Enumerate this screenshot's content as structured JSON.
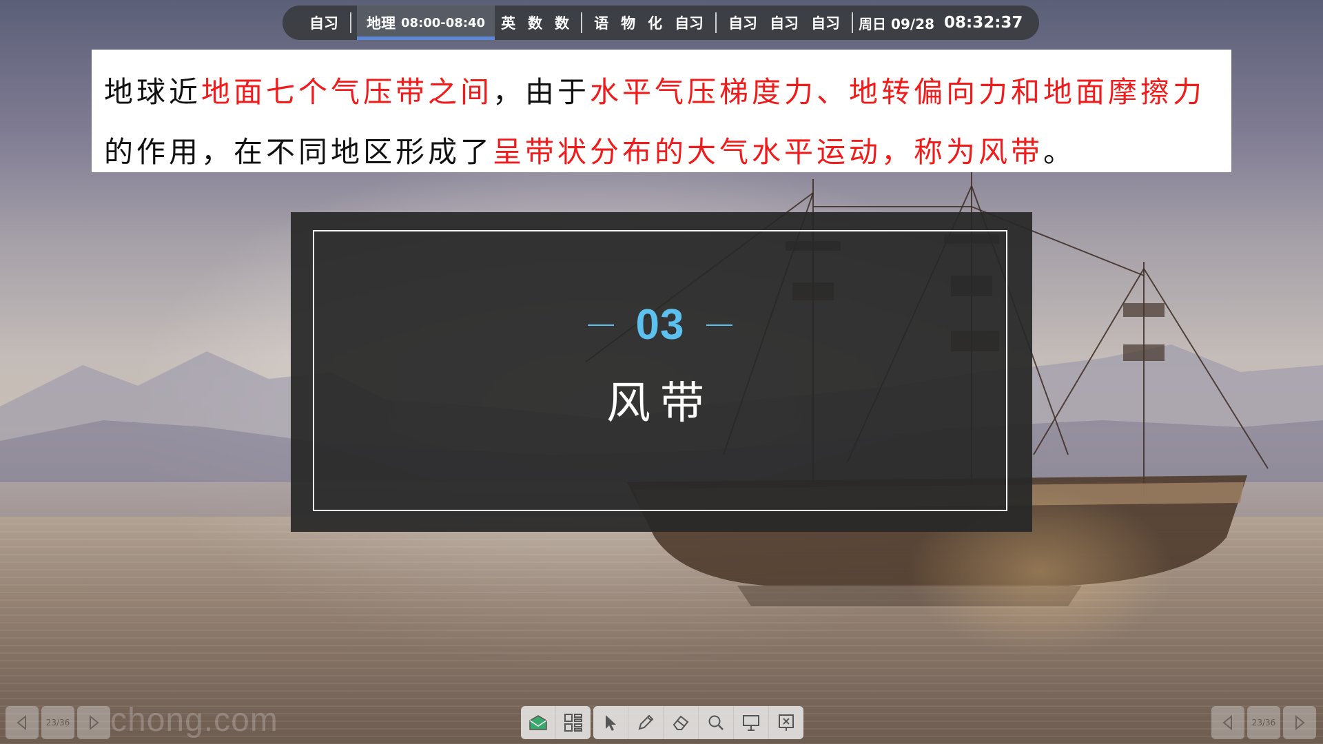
{
  "topbar": {
    "items": [
      {
        "label": "自习"
      },
      {
        "label": "地理",
        "time": "08:00-08:40",
        "active": true
      },
      {
        "label": "英"
      },
      {
        "label": "数"
      },
      {
        "label": "数"
      },
      {
        "label": "语"
      },
      {
        "label": "物"
      },
      {
        "label": "化"
      },
      {
        "label": "自习"
      },
      {
        "label": "自习"
      },
      {
        "label": "自习"
      },
      {
        "label": "自习"
      }
    ],
    "date": "周日 09/28",
    "clock": "08:32:37"
  },
  "definition": {
    "segments": [
      {
        "text": "地球近",
        "red": false
      },
      {
        "text": "地面七个气压带之间",
        "red": true
      },
      {
        "text": "，由于",
        "red": false
      },
      {
        "text": "水平气压梯度力、地转偏向力和地面摩擦力",
        "red": true
      },
      {
        "text": "的作用，在不同地区形成了",
        "red": false
      },
      {
        "text": "呈带状分布的大气水平运动，称为风带",
        "red": true
      },
      {
        "text": "。",
        "red": false
      }
    ]
  },
  "section": {
    "number": "03",
    "title": "风带"
  },
  "page_nav": {
    "indicator": "23/36"
  },
  "toolbar": {
    "tools": [
      "envelope-icon",
      "qr-grid-icon",
      "cursor-icon",
      "pen-icon",
      "eraser-icon",
      "magnifier-icon",
      "presentation-icon",
      "exit-presentation-icon"
    ]
  },
  "watermark": "chong.com",
  "colors": {
    "accent_blue": "#5cc1ef",
    "highlight_red": "#f01c1c",
    "active_tab_underline": "#5b87d6"
  }
}
